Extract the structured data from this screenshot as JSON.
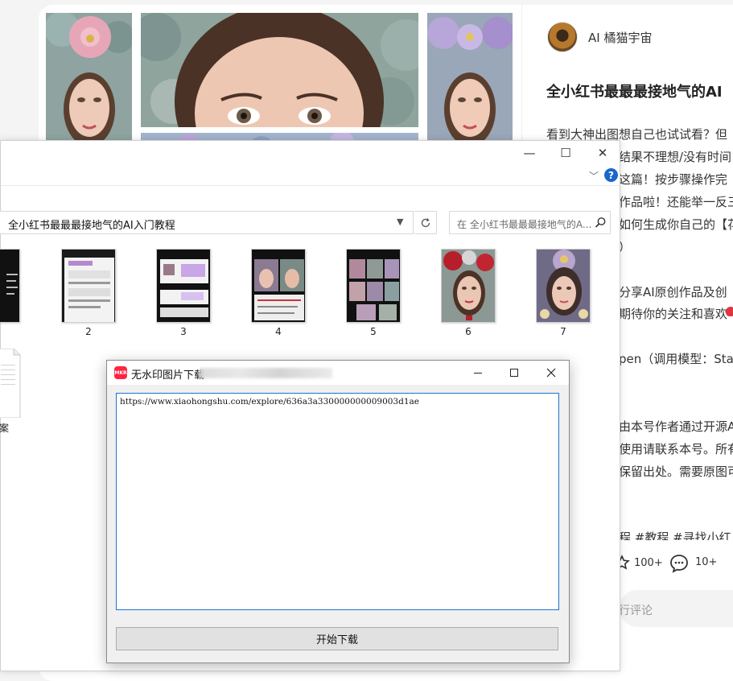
{
  "post": {
    "author_name": "AI 橘猫宇宙",
    "title": "全小红书最最最接地气的AI",
    "body_lines": [
      "看到大神出图想自己也试试看？但",
      "结果不理想/没有时间",
      "这篇！按步骤操作完",
      "作品啦！还能举一反三",
      "如何生成你自己的【花",
      "）",
      "分享AI原创作品及创",
      "期待你的关注和喜欢",
      "pen（调用模型：Sta",
      "由本号作者通过开源A",
      "使用请联系本号。所有",
      "保留出处。需要原图可",
      "程 #教程 #寻找小红"
    ],
    "like_count": "100+",
    "comment_count": "10+",
    "comment_placeholder": "行评论"
  },
  "explorer": {
    "caption": {
      "minimize": "—",
      "maximize": "☐",
      "close": "✕"
    },
    "address": "全小红书最最最接地气的AI入门教程",
    "search_placeholder": "在 全小红书最最最接地气的A...",
    "thumbnails": [
      {
        "label": "",
        "style": "dark-text"
      },
      {
        "label": "2",
        "style": "phone-light"
      },
      {
        "label": "3",
        "style": "phone-chat"
      },
      {
        "label": "4",
        "style": "compare-portraits"
      },
      {
        "label": "5",
        "style": "grid-portraits"
      },
      {
        "label": "6",
        "style": "portrait-roses"
      },
      {
        "label": "7",
        "style": "portrait-crown"
      }
    ],
    "doc_label": "案"
  },
  "dialog": {
    "app_icon_text": "MKR",
    "title": "无水印图片下载",
    "url_value": "https://www.xiaohongshu.com/explore/636a3a330000000009003d1ae",
    "start_button": "开始下载"
  },
  "colors": {
    "brand_red": "#ff2442",
    "focus_blue": "#1e73d0",
    "help_blue": "#1a66c9"
  }
}
